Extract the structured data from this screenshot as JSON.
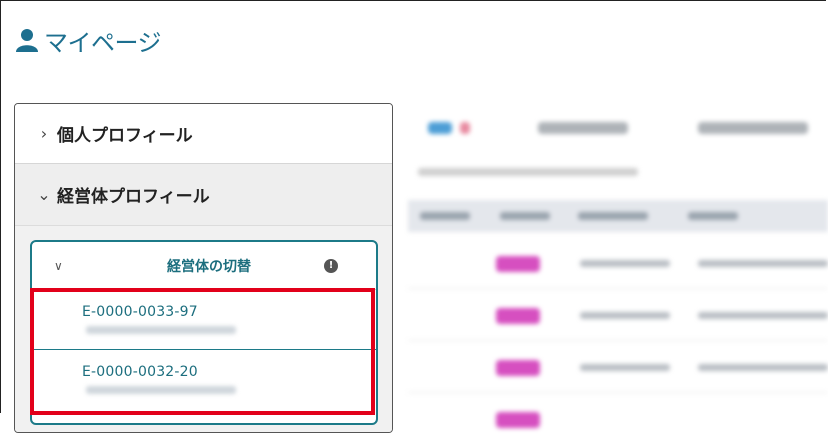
{
  "page": {
    "title": "マイページ",
    "icon": "user-icon"
  },
  "sidebar": {
    "items": [
      {
        "label": "個人プロフィール",
        "state": "collapsed"
      },
      {
        "label": "経営体プロフィール",
        "state": "expanded"
      }
    ],
    "switcher": {
      "label": "経営体の切替",
      "info_icon": "info-icon",
      "entities": [
        {
          "code": "E-0000-0033-97"
        },
        {
          "code": "E-0000-0032-20"
        }
      ]
    }
  },
  "colors": {
    "accent": "#1c6e7e",
    "highlight": "#e2001a",
    "tag": "#d64fc0"
  }
}
